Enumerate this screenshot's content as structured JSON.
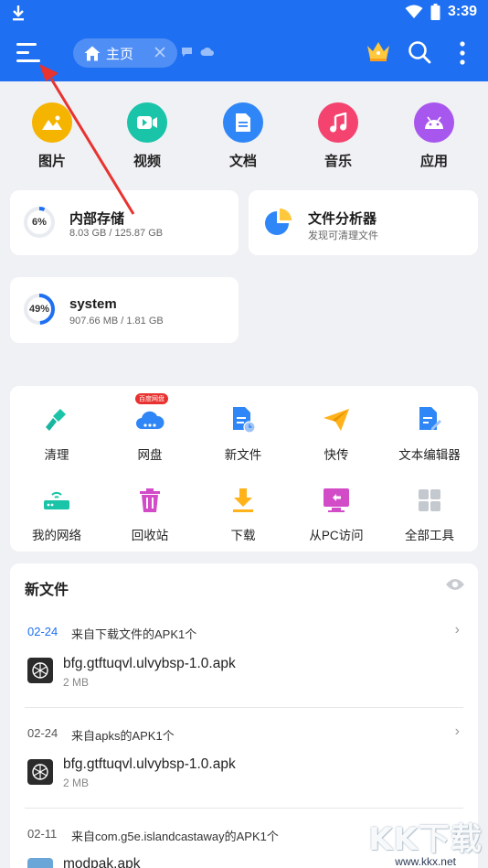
{
  "status": {
    "time": "3:39"
  },
  "header": {
    "tab_label": "主页"
  },
  "categories": [
    {
      "label": "图片",
      "color": "#f5b400",
      "icon": "image-icon"
    },
    {
      "label": "视频",
      "color": "#19c4a8",
      "icon": "video-icon"
    },
    {
      "label": "文档",
      "color": "#2f86f6",
      "icon": "document-icon"
    },
    {
      "label": "音乐",
      "color": "#f4436f",
      "icon": "music-icon"
    },
    {
      "label": "应用",
      "color": "#a857ee",
      "icon": "android-icon"
    }
  ],
  "storage": {
    "internal": {
      "title": "内部存储",
      "usage": "8.03 GB / 125.87 GB",
      "percent_label": "6%",
      "fraction": 0.06
    },
    "analyzer": {
      "title": "文件分析器",
      "subtitle": "发现可清理文件"
    },
    "system": {
      "title": "system",
      "usage": "907.66 MB / 1.81 GB",
      "percent_label": "49%",
      "fraction": 0.49
    }
  },
  "tools": {
    "badge": "百度网盘",
    "items": [
      {
        "label": "清理",
        "icon": "broom-icon"
      },
      {
        "label": "网盘",
        "icon": "cloud-drive-icon"
      },
      {
        "label": "新文件",
        "icon": "new-file-icon"
      },
      {
        "label": "快传",
        "icon": "paper-plane-icon"
      },
      {
        "label": "文本编辑器",
        "icon": "text-editor-icon"
      },
      {
        "label": "我的网络",
        "icon": "router-icon"
      },
      {
        "label": "回收站",
        "icon": "trash-icon"
      },
      {
        "label": "下载",
        "icon": "download-icon"
      },
      {
        "label": "从PC访问",
        "icon": "pc-access-icon"
      },
      {
        "label": "全部工具",
        "icon": "grid-icon"
      }
    ]
  },
  "new_files": {
    "title": "新文件",
    "groups": [
      {
        "date": "02-24",
        "source": "来自下载文件的APK1个",
        "file": "bfg.gtftuqvl.ulvybsp-1.0.apk",
        "size": "2 MB"
      },
      {
        "date": "02-24",
        "source": "来自apks的APK1个",
        "file": "bfg.gtftuqvl.ulvybsp-1.0.apk",
        "size": "2 MB"
      },
      {
        "date": "02-11",
        "source": "来自com.g5e.islandcastaway的APK1个",
        "file": "modpak.apk",
        "size": ""
      }
    ]
  },
  "watermark": {
    "text": "KK下载",
    "url": "www.kkx.net"
  }
}
